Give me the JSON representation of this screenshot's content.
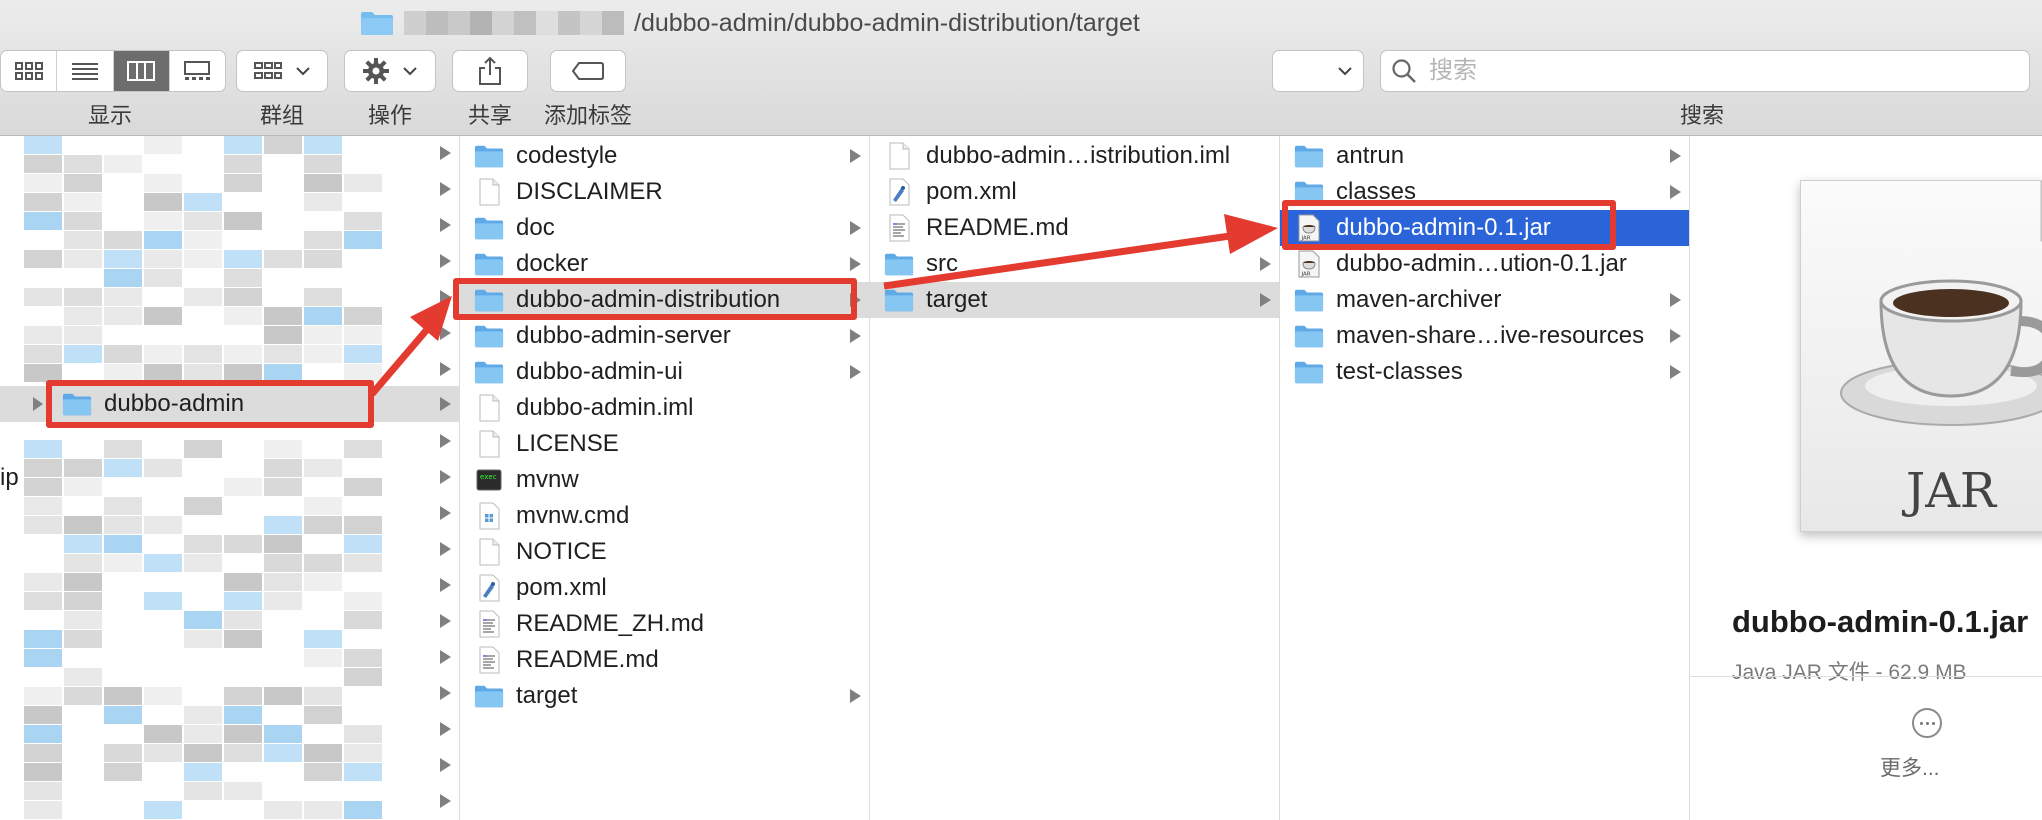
{
  "window": {
    "path_suffix": "/dubbo-admin/dubbo-admin-distribution/target"
  },
  "toolbar": {
    "view_label": "显示",
    "group_label": "群组",
    "action_label": "操作",
    "share_label": "共享",
    "tag_label": "添加标签",
    "search_label": "搜索",
    "search_placeholder": "搜索",
    "active_view": "columns"
  },
  "columns": {
    "col1": {
      "selected": "dubbo-admin",
      "fragment_text": "ip"
    },
    "col2": {
      "items": [
        {
          "name": "codestyle",
          "kind": "folder",
          "has_children": true
        },
        {
          "name": "DISCLAIMER",
          "kind": "file",
          "has_children": false
        },
        {
          "name": "doc",
          "kind": "folder",
          "has_children": true
        },
        {
          "name": "docker",
          "kind": "folder",
          "has_children": true
        },
        {
          "name": "dubbo-admin-distribution",
          "kind": "folder",
          "has_children": true,
          "selected": true
        },
        {
          "name": "dubbo-admin-server",
          "kind": "folder",
          "has_children": true
        },
        {
          "name": "dubbo-admin-ui",
          "kind": "folder",
          "has_children": true
        },
        {
          "name": "dubbo-admin.iml",
          "kind": "file",
          "has_children": false
        },
        {
          "name": "LICENSE",
          "kind": "file",
          "has_children": false
        },
        {
          "name": "mvnw",
          "kind": "exec",
          "has_children": false
        },
        {
          "name": "mvnw.cmd",
          "kind": "cmd",
          "has_children": false
        },
        {
          "name": "NOTICE",
          "kind": "file",
          "has_children": false
        },
        {
          "name": "pom.xml",
          "kind": "xml",
          "has_children": false
        },
        {
          "name": "README_ZH.md",
          "kind": "text",
          "has_children": false
        },
        {
          "name": "README.md",
          "kind": "text",
          "has_children": false
        },
        {
          "name": "target",
          "kind": "folder",
          "has_children": true
        }
      ]
    },
    "col3": {
      "items": [
        {
          "name": "dubbo-admin…istribution.iml",
          "kind": "file",
          "has_children": false
        },
        {
          "name": "pom.xml",
          "kind": "xml",
          "has_children": false
        },
        {
          "name": "README.md",
          "kind": "text",
          "has_children": false
        },
        {
          "name": "src",
          "kind": "folder",
          "has_children": true
        },
        {
          "name": "target",
          "kind": "folder",
          "has_children": true,
          "selected": true
        }
      ]
    },
    "col4": {
      "items": [
        {
          "name": "antrun",
          "kind": "folder",
          "has_children": true
        },
        {
          "name": "classes",
          "kind": "folder",
          "has_children": true
        },
        {
          "name": "dubbo-admin-0.1.jar",
          "kind": "jar",
          "has_children": false,
          "selected": true
        },
        {
          "name": "dubbo-admin…ution-0.1.jar",
          "kind": "jar",
          "has_children": false
        },
        {
          "name": "maven-archiver",
          "kind": "folder",
          "has_children": true
        },
        {
          "name": "maven-share…ive-resources",
          "kind": "folder",
          "has_children": true
        },
        {
          "name": "test-classes",
          "kind": "folder",
          "has_children": true
        }
      ]
    }
  },
  "preview": {
    "icon_label": "JAR",
    "filename": "dubbo-admin-0.1.jar",
    "subtitle": "Java JAR 文件 - 62.9 MB",
    "more_label": "更多..."
  },
  "colors": {
    "highlight": "#e33b30",
    "selection_blue": "#2a64d8",
    "folder_blue": "#67b4ec"
  }
}
